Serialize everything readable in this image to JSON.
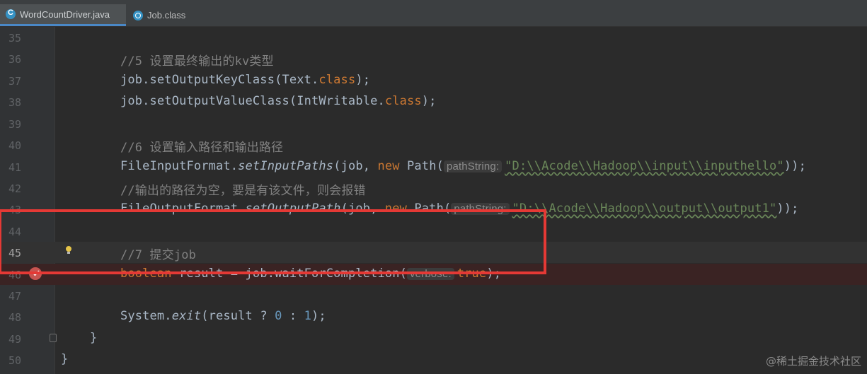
{
  "tabs": [
    {
      "label": "WordCountDriver.java",
      "icon": "java-class-icon",
      "active": true
    },
    {
      "label": "Job.class",
      "icon": "class-file-icon",
      "active": false
    }
  ],
  "lines": [
    {
      "num": "35"
    },
    {
      "num": "36",
      "comment": "//5 设置最终输出的kv类型"
    },
    {
      "num": "37",
      "a": "job.setOutputKeyClass(Text.",
      "kw": "class",
      "b": ");"
    },
    {
      "num": "38",
      "a": "job.setOutputValueClass(IntWritable.",
      "kw": "class",
      "b": ");"
    },
    {
      "num": "39"
    },
    {
      "num": "40",
      "comment": "//6 设置输入路径和输出路径"
    },
    {
      "num": "41",
      "cls": "FileInputFormat.",
      "method": "setInputPaths",
      "mid": "(job, ",
      "kw": "new",
      "ctor": " Path(",
      "hint": "pathString:",
      "str": "\"D:\\\\Acode\\\\Hadoop\\\\input\\\\inputhello\"",
      "end": "));"
    },
    {
      "num": "42",
      "comment": "//输出的路径为空，要是有该文件，则会报错"
    },
    {
      "num": "43",
      "cls": "FileOutputFormat.",
      "method": "setOutputPath",
      "mid": "(job, ",
      "kw": "new",
      "ctor": " Path(",
      "hint": "pathString:",
      "str": "\"D:\\\\Acode\\\\Hadoop\\\\output\\\\output1\"",
      "end": "));"
    },
    {
      "num": "44"
    },
    {
      "num": "45",
      "comment": "//7 提交job"
    },
    {
      "num": "46",
      "kw": "boolean",
      "a": " result = job.waitForCompletion(",
      "hint": "verbose:",
      "kw2": "true",
      "b": ");"
    },
    {
      "num": "47"
    },
    {
      "num": "48",
      "a": "System.",
      "method": "exit",
      "b": "(result ? ",
      "n0": "0",
      "c": " : ",
      "n1": "1",
      "d": ");"
    },
    {
      "num": "49",
      "a": "}"
    },
    {
      "num": "50",
      "a": "}"
    }
  ],
  "watermark": "@稀土掘金技术社区"
}
